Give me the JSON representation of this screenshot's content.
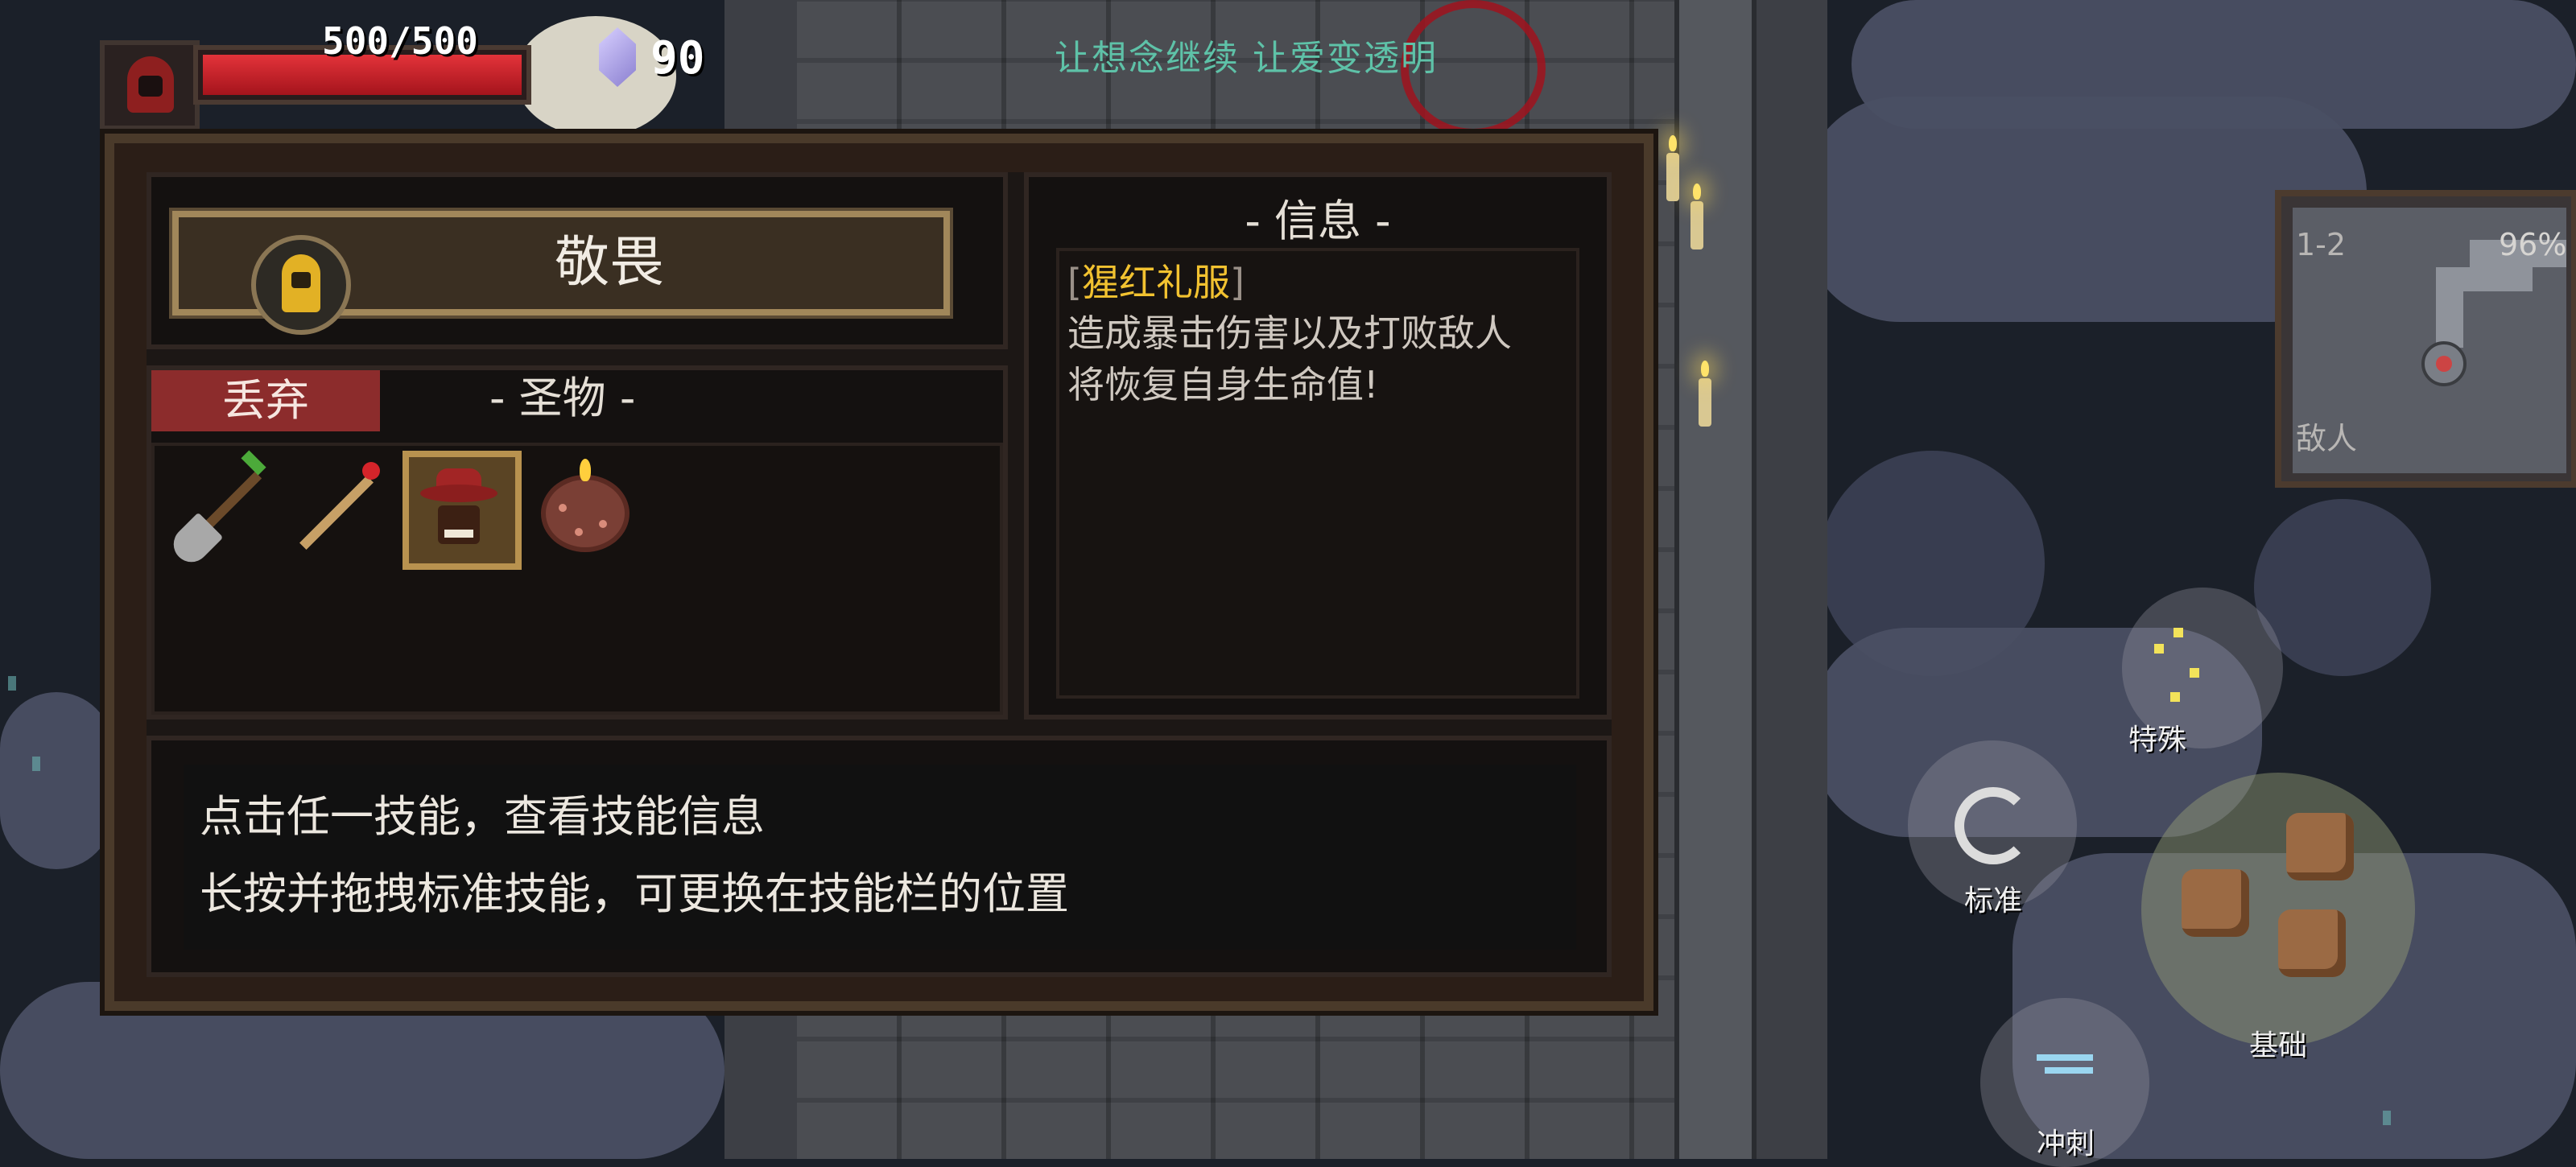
{
  "hud": {
    "hp_text": "500/500",
    "hp_fraction": 1.0,
    "gem_count": "90",
    "slogan": "让想念继续 让爱变透明"
  },
  "panel": {
    "character_name": "敬畏",
    "discard_label": "丢弃",
    "relic_header": "- 圣物 -",
    "info_header": "- 信息 -",
    "selected_item": {
      "bracket_open": "[",
      "name": "猩红礼服",
      "bracket_close": "]",
      "desc_line1": "造成暴击伤害以及打败敌人",
      "desc_line2": "将恢复自身生命值!"
    },
    "relics": [
      {
        "icon": "shovel-icon"
      },
      {
        "icon": "match-icon"
      },
      {
        "icon": "red-hat-icon",
        "selected": true
      },
      {
        "icon": "cake-icon"
      }
    ],
    "help_line1": "点击任一技能，查看技能信息",
    "help_line2": "长按并拖拽标准技能，可更换在技能栏的位置"
  },
  "minimap": {
    "level": "1-2",
    "percent": "96%",
    "enemies_label": "敌人"
  },
  "skills": {
    "special": "特殊",
    "standard": "标准",
    "basic": "基础",
    "dash": "冲刺"
  },
  "colors": {
    "hp_red": "#e3333a",
    "item_name_gold": "#f2c230",
    "discard_red": "#8c2c2c",
    "slogan_teal": "#5ec2a8"
  }
}
